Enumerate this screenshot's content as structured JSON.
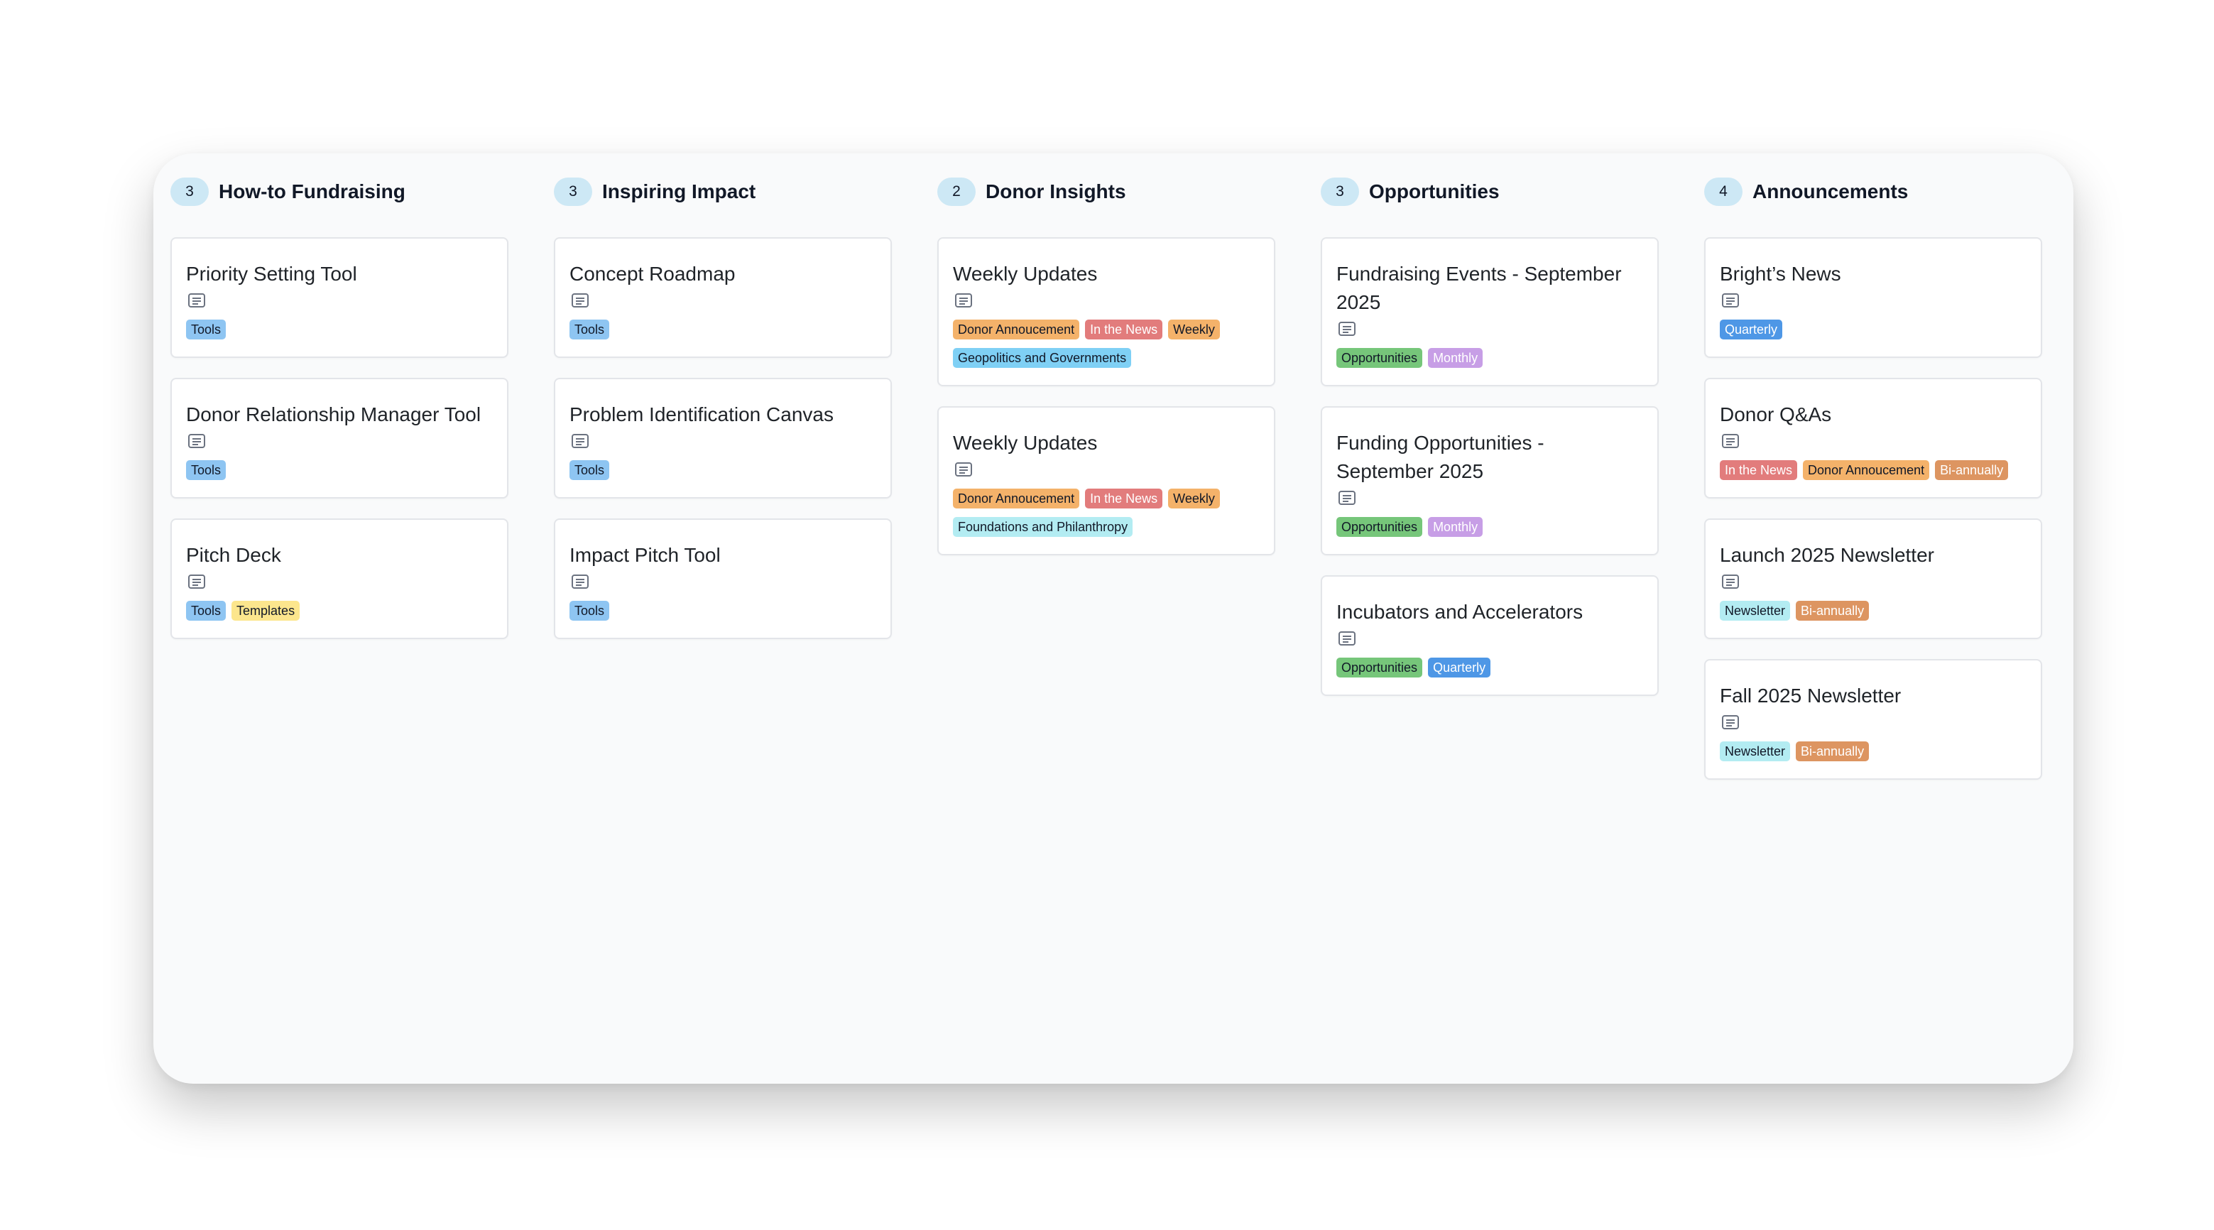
{
  "colors": {
    "board_bg": "#f9fafb",
    "count_pill": "#cde8f5",
    "tag_tools": "#8ec5f2",
    "tag_templates": "#fce68d",
    "tag_donor_annoucement": "#f4b26a",
    "tag_in_the_news": "#e27c7c",
    "tag_weekly": "#f4b26a",
    "tag_geopolitics": "#7fd0f5",
    "tag_foundations": "#b3ecf2",
    "tag_opportunities": "#76c67a",
    "tag_monthly": "#c79ee6",
    "tag_quarterly": "#4e97e6",
    "tag_newsletter": "#b3ecf2",
    "tag_bi_annually": "#dd9561"
  },
  "columns": [
    {
      "count": "3",
      "title": "How-to Fundraising",
      "cards": [
        {
          "title": "Priority Setting Tool",
          "icon": "note-icon",
          "tags": [
            {
              "label": "Tools",
              "color": "#8ec5f2",
              "light": false
            }
          ]
        },
        {
          "title": "Donor Relationship Manager Tool",
          "icon": "note-icon",
          "tags": [
            {
              "label": "Tools",
              "color": "#8ec5f2",
              "light": false
            }
          ]
        },
        {
          "title": "Pitch Deck",
          "icon": "note-icon",
          "tags": [
            {
              "label": "Tools",
              "color": "#8ec5f2",
              "light": false
            },
            {
              "label": "Templates",
              "color": "#fce68d",
              "light": false
            }
          ]
        }
      ]
    },
    {
      "count": "3",
      "title": "Inspiring Impact",
      "cards": [
        {
          "title": "Concept Roadmap",
          "icon": "note-icon",
          "tags": [
            {
              "label": "Tools",
              "color": "#8ec5f2",
              "light": false
            }
          ]
        },
        {
          "title": "Problem Identification Canvas",
          "icon": "note-icon",
          "tags": [
            {
              "label": "Tools",
              "color": "#8ec5f2",
              "light": false
            }
          ]
        },
        {
          "title": "Impact Pitch Tool",
          "icon": "note-icon",
          "tags": [
            {
              "label": "Tools",
              "color": "#8ec5f2",
              "light": false
            }
          ]
        }
      ]
    },
    {
      "count": "2",
      "title": "Donor Insights",
      "cards": [
        {
          "title": "Weekly Updates",
          "icon": "note-icon",
          "tags": [
            {
              "label": "Donor Annoucement",
              "color": "#f4b26a",
              "light": false
            },
            {
              "label": "In the News",
              "color": "#e27c7c",
              "light": true
            },
            {
              "label": "Weekly",
              "color": "#f4b26a",
              "light": false
            },
            {
              "label": "Geopolitics and Governments",
              "color": "#7fd0f5",
              "light": false
            }
          ]
        },
        {
          "title": "Weekly Updates",
          "icon": "note-icon",
          "tags": [
            {
              "label": "Donor Annoucement",
              "color": "#f4b26a",
              "light": false
            },
            {
              "label": "In the News",
              "color": "#e27c7c",
              "light": true
            },
            {
              "label": "Weekly",
              "color": "#f4b26a",
              "light": false
            },
            {
              "label": "Foundations and Philanthropy",
              "color": "#b3ecf2",
              "light": false
            }
          ]
        }
      ]
    },
    {
      "count": "3",
      "title": "Opportunities",
      "cards": [
        {
          "title": "Fundraising Events - September 2025",
          "icon": "note-icon",
          "tags": [
            {
              "label": "Opportunities",
              "color": "#76c67a",
              "light": false
            },
            {
              "label": "Monthly",
              "color": "#c79ee6",
              "light": true
            }
          ]
        },
        {
          "title": "Funding Opportunities - September 2025",
          "icon": "note-icon",
          "tags": [
            {
              "label": "Opportunities",
              "color": "#76c67a",
              "light": false
            },
            {
              "label": "Monthly",
              "color": "#c79ee6",
              "light": true
            }
          ]
        },
        {
          "title": "Incubators and Accelerators",
          "icon": "note-icon",
          "tags": [
            {
              "label": "Opportunities",
              "color": "#76c67a",
              "light": false
            },
            {
              "label": "Quarterly",
              "color": "#4e97e6",
              "light": true
            }
          ]
        }
      ]
    },
    {
      "count": "4",
      "title": "Announcements",
      "cards": [
        {
          "title": "Bright’s News",
          "icon": "note-icon",
          "tags": [
            {
              "label": "Quarterly",
              "color": "#4e97e6",
              "light": true
            }
          ]
        },
        {
          "title": "Donor Q&As",
          "icon": "note-icon",
          "tags": [
            {
              "label": "In the News",
              "color": "#e27c7c",
              "light": true
            },
            {
              "label": "Donor Annoucement",
              "color": "#f4b26a",
              "light": false
            },
            {
              "label": "Bi-annually",
              "color": "#dd9561",
              "light": true
            }
          ]
        },
        {
          "title": "Launch 2025 Newsletter",
          "icon": "note-icon",
          "tags": [
            {
              "label": "Newsletter",
              "color": "#b3ecf2",
              "light": false
            },
            {
              "label": "Bi-annually",
              "color": "#dd9561",
              "light": true
            }
          ]
        },
        {
          "title": "Fall 2025 Newsletter",
          "icon": "note-icon",
          "tags": [
            {
              "label": "Newsletter",
              "color": "#b3ecf2",
              "light": false
            },
            {
              "label": "Bi-annually",
              "color": "#dd9561",
              "light": true
            }
          ]
        }
      ]
    }
  ]
}
